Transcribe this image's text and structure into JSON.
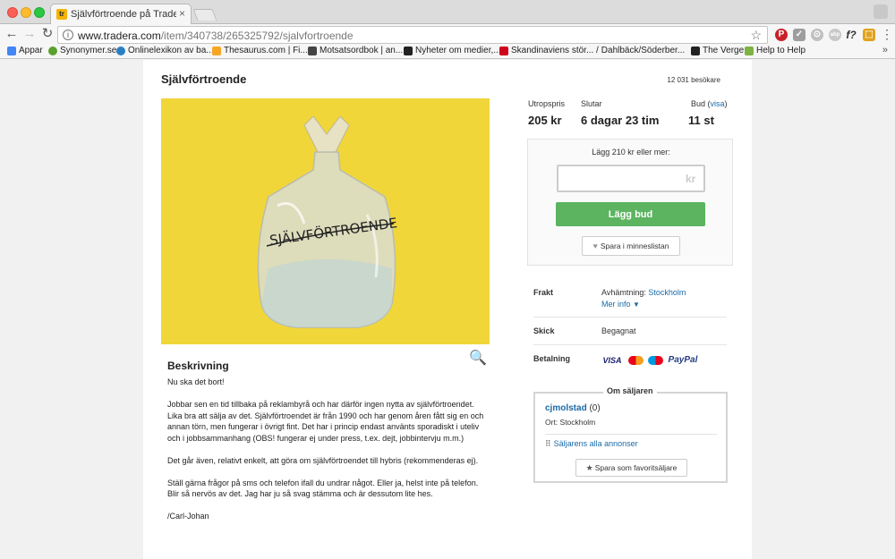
{
  "browser": {
    "tab_title": "Självförtroende på Tradera.com",
    "tab_favicon": "tr",
    "url_host": "www.tradera.com",
    "url_path": "/item/340738/265325792/sjalvfortroende",
    "bookmarks": [
      {
        "label": "Appar",
        "icon": "apps-icon",
        "color": "#4285f4"
      },
      {
        "label": "Synonymer.se",
        "icon": "synonymer-icon",
        "color": "#5aa02c"
      },
      {
        "label": "Onlinelexikon av ba...",
        "icon": "lexikon-icon",
        "color": "#2a7fc4"
      },
      {
        "label": "Thesaurus.com | Fi...",
        "icon": "thesaurus-icon",
        "color": "#f5a623"
      },
      {
        "label": "Motsatsordbok | an...",
        "icon": "motsats-icon",
        "color": "#444444"
      },
      {
        "label": "Nyheter om medier,...",
        "icon": "dm-icon",
        "color": "#222222"
      },
      {
        "label": "Skandinaviens stör...",
        "icon": "skandinaviens-icon",
        "color": "#d0021b"
      },
      {
        "label": "Dahlbäck/Söderber...",
        "icon": "slash-icon",
        "color": "#222222"
      },
      {
        "label": "The Verge",
        "icon": "verge-icon",
        "color": "#222222"
      },
      {
        "label": "Help to Help",
        "icon": "help-icon",
        "color": "#7cb342"
      }
    ],
    "extensions": [
      "P",
      "✓",
      "⊙",
      "abp",
      "f?",
      "⬚"
    ]
  },
  "listing": {
    "title": "Självförtroende",
    "visitors": "12 031 besökare",
    "image_text": "SJÄLVFÖRTROENDE",
    "buy_now_label": "Utropspris",
    "buy_now_value": "205 kr",
    "ends_label": "Slutar",
    "ends_value": "6 dagar 23 tim",
    "bids_label": "Bud",
    "bids_link": "visa",
    "bids_value": "11 st",
    "bid_min_text": "Lägg 210 kr eller mer:",
    "bid_currency": "kr",
    "bid_input_value": "",
    "bid_button": "Lägg bud",
    "save_button": "Spara i minneslistan",
    "shipping_label": "Frakt",
    "shipping_value": "Avhämtning:",
    "shipping_city": "Stockholm",
    "more_info": "Mer info",
    "condition_label": "Skick",
    "condition_value": "Begagnat",
    "payment_label": "Betalning",
    "payment_methods": [
      "VISA",
      "MasterCard",
      "Maestro",
      "PayPal"
    ]
  },
  "description": {
    "heading": "Beskrivning",
    "paragraphs": [
      "Nu ska det bort!",
      "Jobbar sen en tid tillbaka på reklambyrå och har därför ingen nytta av självförtroendet. Lika bra att sälja av det. Självförtroendet är från 1990 och har genom åren fått sig en och annan törn, men fungerar i övrigt fint. Det har i princip endast använts sporadiskt i uteliv och i jobbsammanhang (OBS! fungerar ej under press, t.ex. dejt, jobbintervju m.m.)",
      "Det går även, relativt enkelt, att göra om självförtroendet till hybris (rekommenderas ej).",
      "Ställ gärna frågor på sms och telefon ifall du undrar något. Eller ja, helst inte på telefon. Blir så nervös av det. Jag har ju så svag stämma och är dessutom lite hes.",
      "/Carl-Johan"
    ]
  },
  "seller": {
    "heading": "Om säljaren",
    "name": "cjmolstad",
    "rating": "(0)",
    "city": "Ort: Stockholm",
    "listings_link": "Säljarens alla annonser",
    "favorite_button": "Spara som favoritsäljare"
  },
  "colors": {
    "accent_green": "#5cb360",
    "link_blue": "#1a6aa8",
    "image_yellow": "#f1d63a"
  }
}
